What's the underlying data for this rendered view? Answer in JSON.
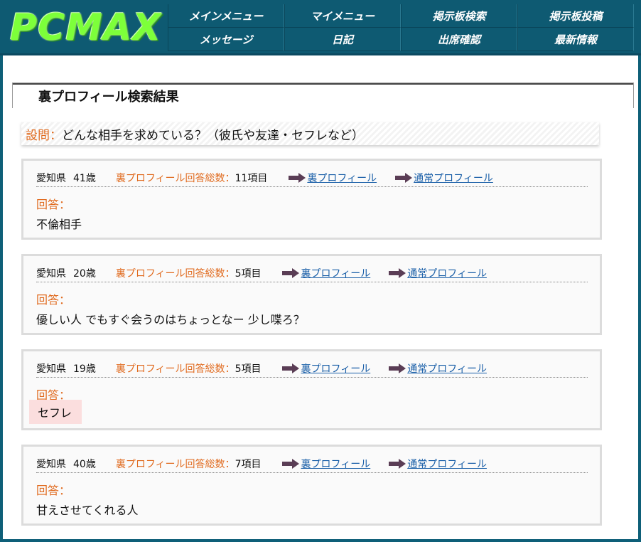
{
  "header": {
    "logo_text": "PCMAX",
    "nav": [
      "メインメニュー",
      "マイメニュー",
      "掲示板検索",
      "掲示板投稿",
      "メッセージ",
      "日記",
      "出席確認",
      "最新情報"
    ]
  },
  "section_title": "裏プロフィール検索結果",
  "question": {
    "label": "設問：",
    "text": "どんな相手を求めている？（彼氏や友達・セフレなど）"
  },
  "results": [
    {
      "prefecture": "愛知県",
      "age": "41歳",
      "count_label": "裏プロフィール回答総数：",
      "count_value": "11項目",
      "link_ura": "裏プロフィール",
      "link_normal": "通常プロフィール",
      "answer_label": "回答：",
      "answer": "不倫相手"
    },
    {
      "prefecture": "愛知県",
      "age": "20歳",
      "count_label": "裏プロフィール回答総数：",
      "count_value": "5項目",
      "link_ura": "裏プロフィール",
      "link_normal": "通常プロフィール",
      "answer_label": "回答：",
      "answer": "優しい人 でもすぐ会うのはちょっとなー 少し喋ろ？"
    },
    {
      "prefecture": "愛知県",
      "age": "19歳",
      "count_label": "裏プロフィール回答総数：",
      "count_value": "5項目",
      "link_ura": "裏プロフィール",
      "link_normal": "通常プロフィール",
      "answer_label": "回答：",
      "answer": "セフレ"
    },
    {
      "prefecture": "愛知県",
      "age": "40歳",
      "count_label": "裏プロフィール回答総数：",
      "count_value": "7項目",
      "link_ura": "裏プロフィール",
      "link_normal": "通常プロフィール",
      "answer_label": "回答：",
      "answer": "甘えさせてくれる人"
    }
  ],
  "colors": {
    "header_bg": "#0e5a72",
    "logo_green": "#7dff3a",
    "accent_orange": "#e06a1e",
    "link_blue": "#1a5fa8",
    "arrow": "#5a3d55",
    "highlight": "#fbdede"
  }
}
